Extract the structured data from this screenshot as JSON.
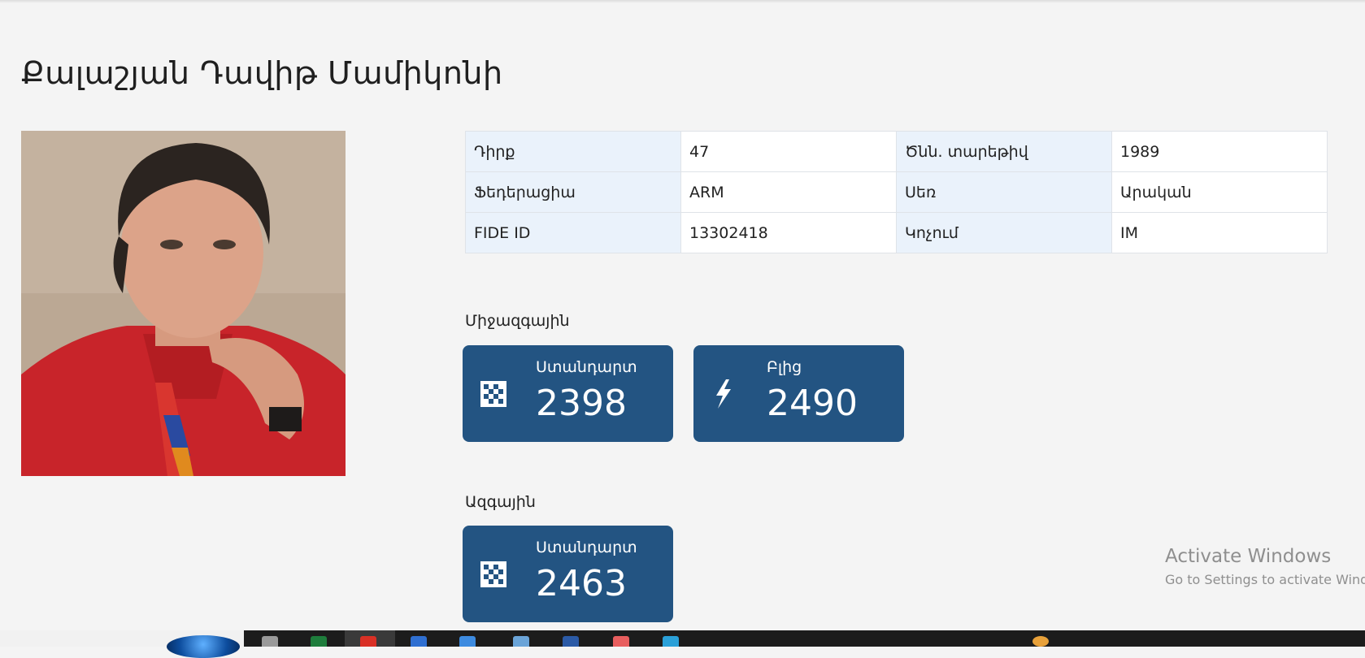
{
  "player": {
    "name": "Քալաշյան Դավիթ Մամիկոնի"
  },
  "info_table": [
    {
      "label1": "Դիրք",
      "value1": "47",
      "label2": "Ծնն. տարեթիվ",
      "value2": "1989"
    },
    {
      "label1": "Ֆեդերացիա",
      "value1": "ARM",
      "label2": "Սեռ",
      "value2": "Արական"
    },
    {
      "label1": "FIDE ID",
      "value1": "13302418",
      "label2": "Կոչում",
      "value2": "IM"
    }
  ],
  "international": {
    "heading": "Միջազգային",
    "cards": [
      {
        "name": "Ստանդարտ",
        "value": "2398",
        "icon": "chessboard-icon"
      },
      {
        "name": "Բլից",
        "value": "2490",
        "icon": "lightning-icon"
      }
    ]
  },
  "national": {
    "heading": "Ազգային",
    "cards": [
      {
        "name": "Ստանդարտ",
        "value": "2463",
        "icon": "chessboard-icon"
      }
    ]
  },
  "watermark": {
    "line1": "Activate Windows",
    "line2": "Go to Settings to activate Windows."
  },
  "colors": {
    "card_bg": "#235482",
    "label_cell_bg": "#eaf2fb",
    "page_bg": "#f4f4f4"
  }
}
